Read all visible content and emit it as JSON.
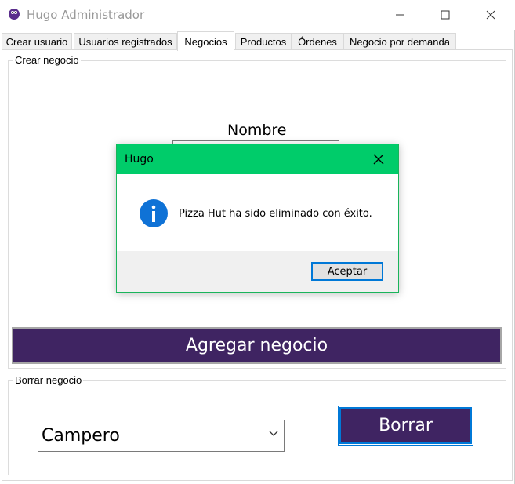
{
  "window": {
    "title": "Hugo Administrador",
    "icon": "app-logo-icon"
  },
  "tabs": [
    {
      "label": "Crear usuario",
      "active": false
    },
    {
      "label": "Usuarios registrados",
      "active": false
    },
    {
      "label": "Negocios",
      "active": true
    },
    {
      "label": "Productos",
      "active": false
    },
    {
      "label": "Órdenes",
      "active": false
    },
    {
      "label": "Negocio por demanda",
      "active": false
    }
  ],
  "crear_negocio": {
    "group_title": "Crear negocio",
    "nombre_label": "Nombre",
    "nombre_value": "",
    "agregar_button": "Agregar negocio"
  },
  "borrar_negocio": {
    "group_title": "Borrar negocio",
    "selected": "Campero",
    "borrar_button": "Borrar"
  },
  "dialog": {
    "title": "Hugo",
    "message": "Pizza Hut ha sido eliminado con éxito.",
    "ok_button": "Aceptar",
    "icon": "info-icon"
  },
  "colors": {
    "accent_purple": "#3f2462",
    "dialog_title_green": "#00cc6a",
    "focus_blue": "#0078d7",
    "info_blue": "#0f72d6"
  }
}
